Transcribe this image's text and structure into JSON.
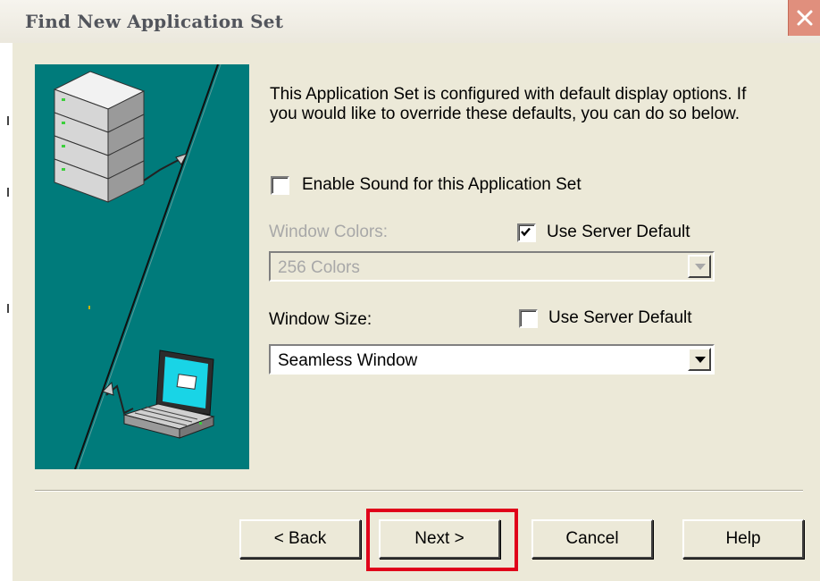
{
  "window": {
    "title": "Find New Application Set",
    "close_label": "close"
  },
  "content": {
    "description": "This Application Set is configured with default display options.  If you would like to override these defaults, you can do so below.",
    "sound_checkbox": {
      "label": "Enable Sound for this Application Set",
      "checked": false
    },
    "window_colors": {
      "label": "Window Colors:",
      "use_server_default": {
        "label": "Use Server Default",
        "checked": true
      },
      "value": "256 Colors",
      "enabled": false
    },
    "window_size": {
      "label": "Window Size:",
      "use_server_default": {
        "label": "Use Server Default",
        "checked": false
      },
      "value": "Seamless Window",
      "enabled": true
    }
  },
  "buttons": {
    "back": "< Back",
    "next": "Next >",
    "cancel": "Cancel",
    "help": "Help"
  },
  "colors": {
    "banner": "#007b7b",
    "highlight": "#e0001a",
    "dialog": "#ece9d8"
  }
}
